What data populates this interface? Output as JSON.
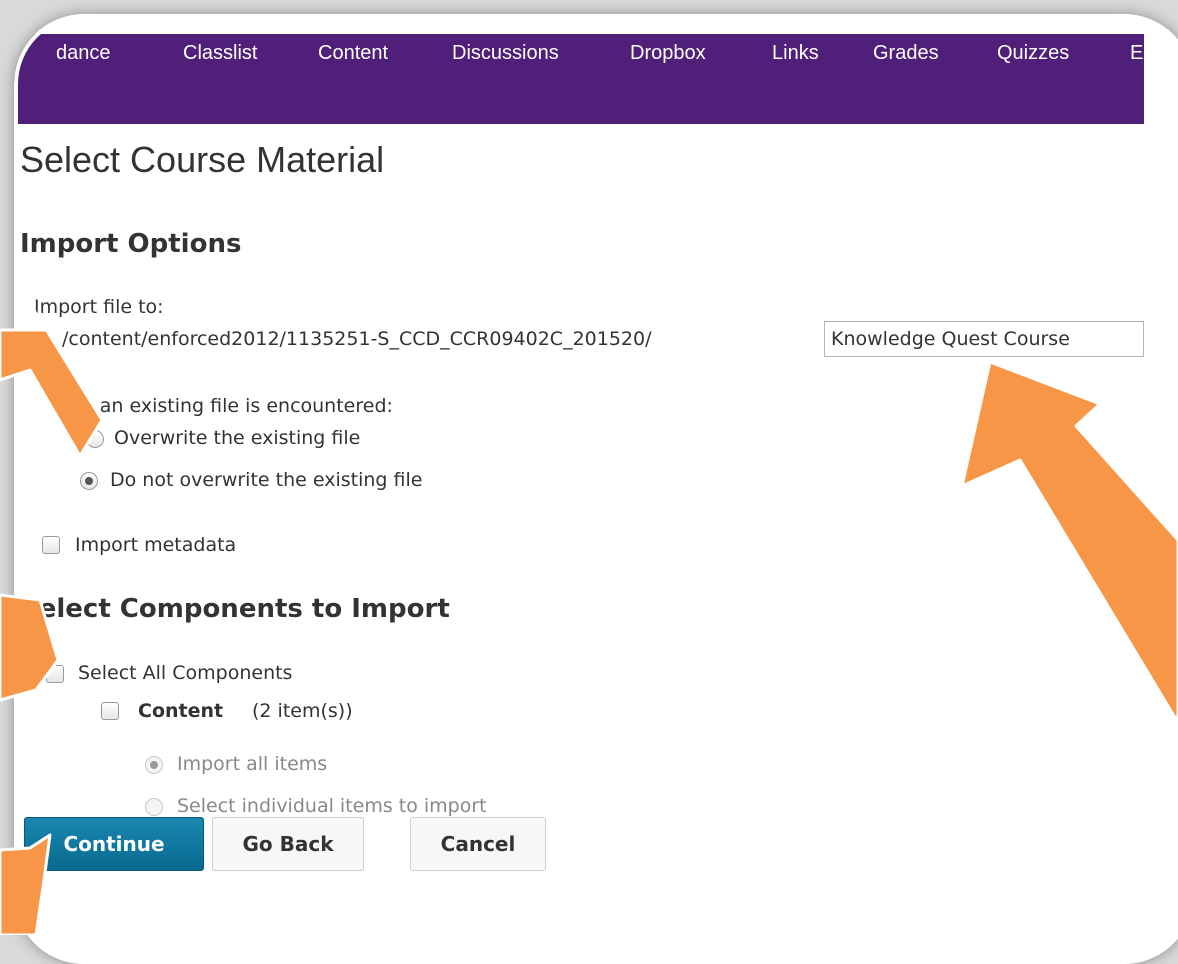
{
  "nav": {
    "items": [
      "dance",
      "Classlist",
      "Content",
      "Discussions",
      "Dropbox",
      "Links",
      "Grades",
      "Quizzes",
      "Ex"
    ],
    "color": "#4f1f7a"
  },
  "page": {
    "title": "Select Course Material"
  },
  "import_options": {
    "heading": "Import Options",
    "import_file_to_label": "Import file to:",
    "path_prefix": "/content/enforced2012/1135251-S_CCD_CCR09402C_201520/",
    "folder_value": "Knowledge Quest Course",
    "existing_file_label": "en an existing file is encountered:",
    "overwrite_option": "Overwrite the existing file",
    "no_overwrite_option": "Do not overwrite the existing file",
    "import_metadata_label": "Import metadata"
  },
  "components": {
    "heading": "Select Components to Import",
    "select_all_label": "Select All Components",
    "content_label": "Content",
    "content_count": "(2 item(s))",
    "import_all_label": "Import all items",
    "select_individual_label": "Select individual items to import"
  },
  "buttons": {
    "continue": "Continue",
    "go_back": "Go Back",
    "cancel": "Cancel"
  },
  "colors": {
    "accent": "#0b7196",
    "annotation_arrow": "#f79646"
  }
}
